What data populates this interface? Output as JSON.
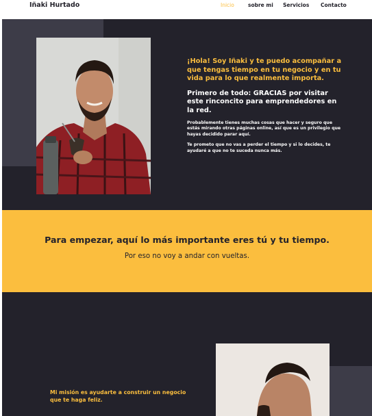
{
  "header": {
    "brand": "Iñaki Hurtado",
    "nav": [
      {
        "label": "Inicio",
        "active": true
      },
      {
        "label": "sobre mi",
        "active": false
      },
      {
        "label": "Servicios",
        "active": false
      },
      {
        "label": "Contacto",
        "active": false
      }
    ]
  },
  "hero": {
    "greeting": "¡Hola! Soy Iñaki y te puedo acompañar a que tengas tiempo en tu negocio y en tu vida para lo que realmente importa.",
    "thanks": "Primero de todo: GRACIAS por visitar este rinconcito para emprendedores en la red.",
    "paragraph1": "Probablemente tienes muchas cosas que hacer y seguro que estás mirando otras páginas online, así que es un privilegio que hayas decidido parar aquí.",
    "paragraph2": "Te prometo que no vas a perder el tiempo y si lo decides, te ayudaré a que no te suceda nunca más."
  },
  "band": {
    "title": "Para empezar, aquí lo más importante eres tú y tu tiempo.",
    "subtitle": "Por eso no voy a andar con vueltas."
  },
  "mission": {
    "title": "Mi misión es ayudarte a construir un negocio que te haga feliz."
  },
  "colors": {
    "accent": "#fbbe3e",
    "dark": "#23222b",
    "block": "#3d3c48"
  }
}
